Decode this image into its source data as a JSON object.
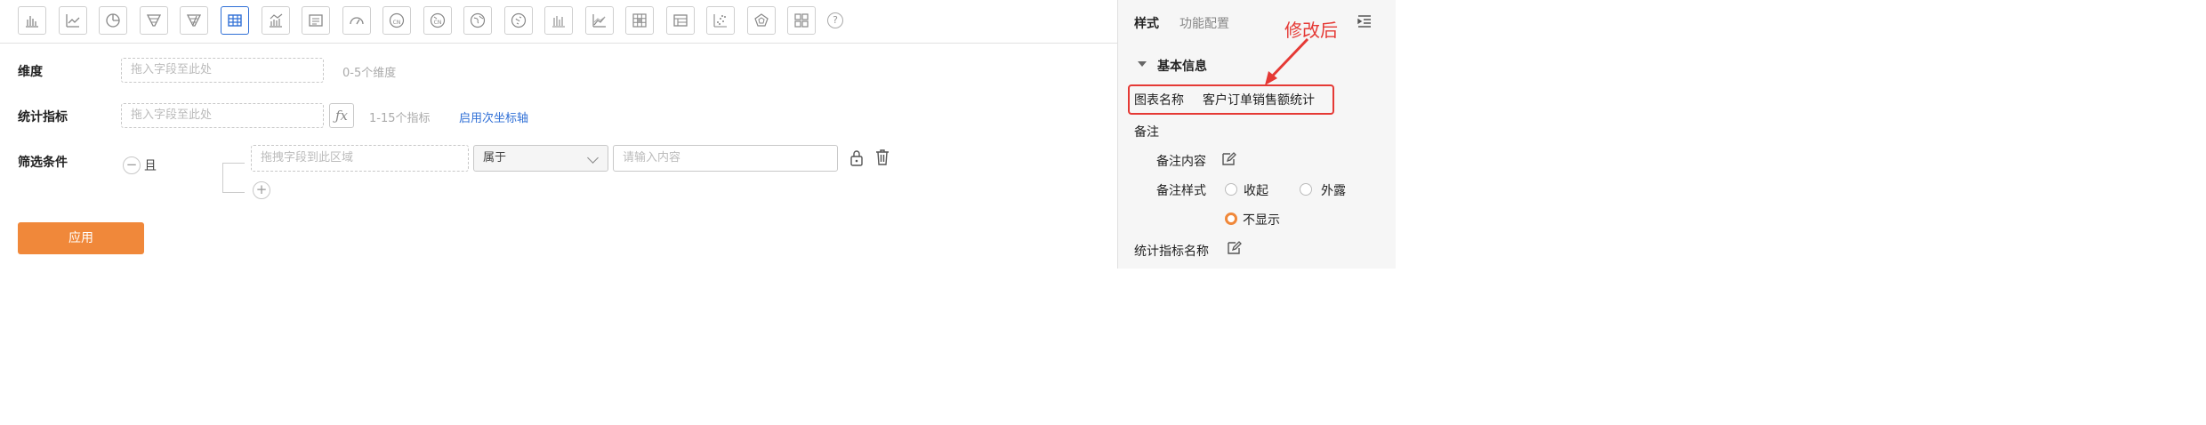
{
  "toolbar": {
    "icons": [
      "bar-chart-icon",
      "line-chart-icon",
      "pie-chart-icon",
      "funnel-icon",
      "filtered-funnel-icon",
      "table-icon",
      "column-line-icon",
      "text-card-icon",
      "gauge-icon",
      "china-map-icon",
      "china-map-alt-icon",
      "world-map-icon",
      "globe-icon",
      "vertical-bars-icon",
      "area-chart-icon",
      "heatmap-icon",
      "crosstab-icon",
      "scatter-icon",
      "radar-icon",
      "grid-layout-icon"
    ],
    "active_index": 5,
    "help_glyph": "?"
  },
  "dimension": {
    "label": "维度",
    "placeholder": "拖入字段至此处",
    "hint": "0-5个维度"
  },
  "metric": {
    "label": "统计指标",
    "placeholder": "拖入字段至此处",
    "fx": "ƒx",
    "hint": "1-15个指标",
    "link": "启用次坐标轴"
  },
  "filter": {
    "label": "筛选条件",
    "minus": "−",
    "logic": "且",
    "field_placeholder": "拖拽字段到此区域",
    "operator": "属于",
    "value_placeholder": "请输入内容",
    "plus": "+"
  },
  "apply_label": "应用",
  "side": {
    "tabs": [
      "样式",
      "功能配置"
    ],
    "active_tab": 0,
    "section_title": "基本信息",
    "chart_name_label": "图表名称",
    "chart_name_value": "客户订单销售额统计",
    "remark_label": "备注",
    "remark_content_label": "备注内容",
    "remark_style_label": "备注样式",
    "remark_style_options": [
      "收起",
      "外露",
      "不显示"
    ],
    "remark_style_selected": 2,
    "metric_name_label": "统计指标名称"
  },
  "annotation": {
    "text": "修改后",
    "color": "#e53935"
  },
  "colors": {
    "accent": "#f0883a",
    "link": "#2f6fd6",
    "active_border": "#2f6fd6"
  }
}
